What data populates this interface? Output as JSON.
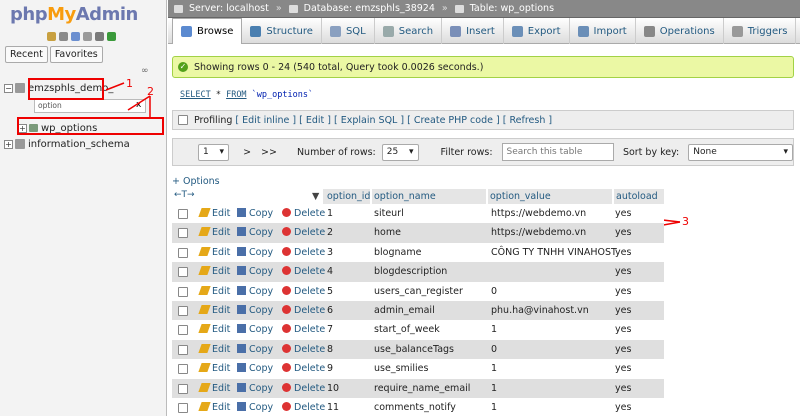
{
  "logo": {
    "php": "php",
    "my": "My",
    "admin": "Admin"
  },
  "left": {
    "tabs": [
      "Recent",
      "Favorites"
    ],
    "link_icon": "link-icon",
    "tree": [
      {
        "label": "emzsphls_demo_",
        "toggle": "−"
      },
      {
        "label": "wp_options",
        "toggle": "+"
      },
      {
        "label": "information_schema",
        "toggle": "+"
      }
    ],
    "filter_value": "option",
    "filter_clear": "x"
  },
  "annotations": [
    "1",
    "2",
    "3"
  ],
  "breadcrumb": [
    "Server: localhost",
    "Database: emzsphls_38924",
    "Table: wp_options"
  ],
  "tabs": [
    {
      "label": "Browse",
      "icon": "browse-icon",
      "color": "#5b8ad0"
    },
    {
      "label": "Structure",
      "icon": "structure-icon",
      "color": "#4a7fb0"
    },
    {
      "label": "SQL",
      "icon": "sql-icon",
      "color": "#8aa0c0"
    },
    {
      "label": "Search",
      "icon": "search-icon",
      "color": "#9aa"
    },
    {
      "label": "Insert",
      "icon": "insert-icon",
      "color": "#7a8fb8"
    },
    {
      "label": "Export",
      "icon": "export-icon",
      "color": "#6b8fb8"
    },
    {
      "label": "Import",
      "icon": "import-icon",
      "color": "#6b8fb8"
    },
    {
      "label": "Operations",
      "icon": "wrench-icon",
      "color": "#888"
    },
    {
      "label": "Triggers",
      "icon": "triggers-icon",
      "color": "#999"
    }
  ],
  "success": "Showing rows 0 - 24 (540 total, Query took 0.0026 seconds.)",
  "sql": {
    "select": "SELECT",
    "star": " * ",
    "from": "FROM",
    "table": " `wp_options`"
  },
  "profiling": {
    "label": "Profiling",
    "links": [
      "[ Edit inline ]",
      "[ Edit ]",
      "[ Explain SQL ]",
      "[ Create PHP code ]",
      "[ Refresh ]"
    ]
  },
  "nav": {
    "page": "1",
    "next": ">",
    "last": ">>",
    "rows_label": "Number of rows:",
    "rows": "25",
    "filter_label": "Filter rows:",
    "filter_placeholder": "Search this table",
    "sort_label": "Sort by key:",
    "sort_value": "None"
  },
  "options_link": "+ Options",
  "col_arrows": "←T→",
  "columns": [
    "option_id",
    "option_name",
    "option_value",
    "autoload"
  ],
  "row_actions": {
    "edit": "Edit",
    "copy": "Copy",
    "delete": "Delete"
  },
  "rows": [
    {
      "id": "1",
      "name": "siteurl",
      "value": "https://webdemo.vn",
      "autoload": "yes"
    },
    {
      "id": "2",
      "name": "home",
      "value": "https://webdemo.vn",
      "autoload": "yes"
    },
    {
      "id": "3",
      "name": "blogname",
      "value": "CÔNG TY TNHH VINAHOST",
      "autoload": "yes"
    },
    {
      "id": "4",
      "name": "blogdescription",
      "value": "",
      "autoload": "yes"
    },
    {
      "id": "5",
      "name": "users_can_register",
      "value": "0",
      "autoload": "yes"
    },
    {
      "id": "6",
      "name": "admin_email",
      "value": "phu.ha@vinahost.vn",
      "autoload": "yes"
    },
    {
      "id": "7",
      "name": "start_of_week",
      "value": "1",
      "autoload": "yes"
    },
    {
      "id": "8",
      "name": "use_balanceTags",
      "value": "0",
      "autoload": "yes"
    },
    {
      "id": "9",
      "name": "use_smilies",
      "value": "1",
      "autoload": "yes"
    },
    {
      "id": "10",
      "name": "require_name_email",
      "value": "1",
      "autoload": "yes"
    },
    {
      "id": "11",
      "name": "comments_notify",
      "value": "1",
      "autoload": "yes"
    }
  ]
}
